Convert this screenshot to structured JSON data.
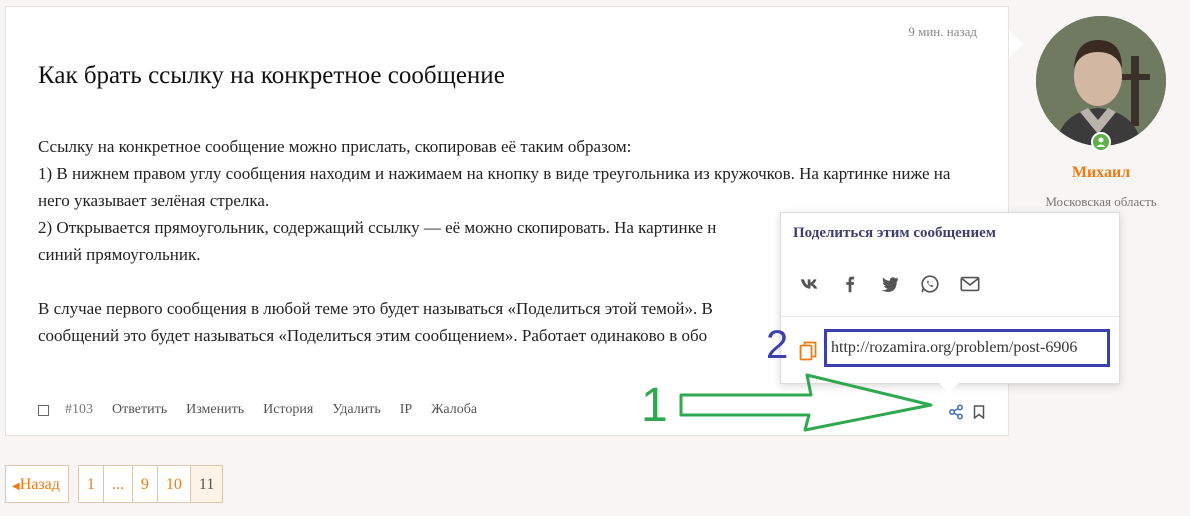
{
  "post": {
    "time": "9 мин. назад",
    "title": "Как брать ссылку на конкретное сообщение",
    "paragraphs": [
      "Ссылку на конкретное сообщение можно прислать, скопировав её таким образом:",
      "1) В нижнем правом углу сообщения находим и нажимаем на кнопку в виде треугольника из кружочков. На картинке ниже на него указывает зелёная стрелка.",
      "2) Открывается прямоугольник, содержащий ссылку — её можно скопировать. На картинке н",
      "синий прямоугольник.",
      "",
      "В случае первого сообщения в любой теме это будет называться «Поделиться этой темой». В",
      "сообщений это будет называться «Поделиться этим сообщением». Работает одинаково в обо"
    ],
    "toolbar": {
      "number": "#103",
      "reply": "Ответить",
      "edit": "Изменить",
      "history": "История",
      "delete": "Удалить",
      "ip": "IP",
      "report": "Жалоба"
    }
  },
  "author": {
    "name": "Михаил",
    "region": "Московская область"
  },
  "share_popup": {
    "title": "Поделиться этим сообщением",
    "social_icons": [
      "vk-icon",
      "facebook-icon",
      "twitter-icon",
      "whatsapp-icon",
      "email-icon"
    ],
    "link": "http://rozamira.org/problem/post-6906"
  },
  "annotations": {
    "step1": "1",
    "step2": "2"
  },
  "pagination": {
    "prev": "Назад",
    "pages": [
      "1",
      "...",
      "9",
      "10",
      "11"
    ],
    "active": "11"
  },
  "colors": {
    "accent": "#f07a12",
    "popup_title": "#3f3e6f",
    "highlight_box": "#3c3fb0",
    "green_arrow": "#2fa84f",
    "online": "#5fb04a"
  }
}
